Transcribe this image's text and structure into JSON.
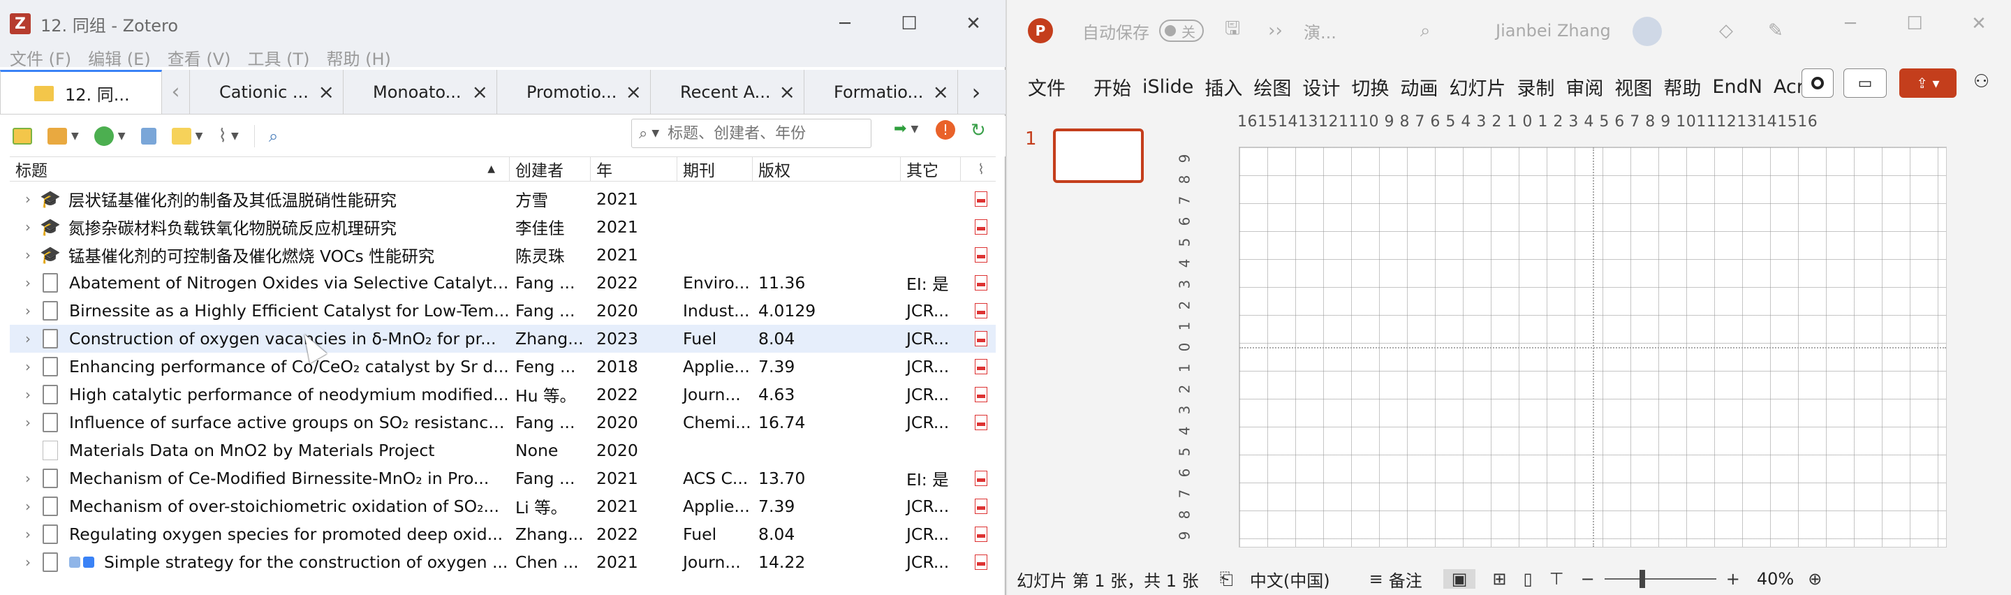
{
  "zotero": {
    "window_title": "12. 同组 - Zotero",
    "menu": [
      "文件 (F)",
      "编辑 (E)",
      "查看 (V)",
      "工具 (T)",
      "帮助 (H)"
    ],
    "library_tab": "12. 同...",
    "tabs": [
      "Cationic ...",
      "Monoato...",
      "Promotio...",
      "Recent A...",
      "Formatio..."
    ],
    "search_placeholder": "标题、创建者、年份",
    "columns": {
      "title": "标题",
      "creator": "创建者",
      "year": "年",
      "publication": "期刊",
      "rights": "版权",
      "extra": "其它"
    },
    "rows": [
      {
        "type": "thesis",
        "title": "层状锰基催化剂的制备及其低温脱硝性能研究",
        "creator": "方雪",
        "year": "2021",
        "publication": "",
        "rights": "",
        "extra": "",
        "pdf": true,
        "selected": false,
        "tags": []
      },
      {
        "type": "thesis",
        "title": "氮掺杂碳材料负载铁氧化物脱硫反应机理研究",
        "creator": "李佳佳",
        "year": "2021",
        "publication": "",
        "rights": "",
        "extra": "",
        "pdf": true,
        "selected": false,
        "tags": []
      },
      {
        "type": "thesis",
        "title": "锰基催化剂的可控制备及催化燃烧 VOCs 性能研究",
        "creator": "陈灵珠",
        "year": "2021",
        "publication": "",
        "rights": "",
        "extra": "",
        "pdf": true,
        "selected": false,
        "tags": []
      },
      {
        "type": "doc",
        "title": "Abatement of Nitrogen Oxides via Selective Catalyti...",
        "creator": "Fang ...",
        "year": "2022",
        "publication": "Enviro...",
        "rights": "11.36",
        "extra": "EI: 是",
        "pdf": true,
        "selected": false,
        "tags": []
      },
      {
        "type": "doc",
        "title": "Birnessite as a Highly Efficient Catalyst for Low-Tem...",
        "creator": "Fang ...",
        "year": "2020",
        "publication": "Indust...",
        "rights": "4.0129",
        "extra": "JCR...",
        "pdf": true,
        "selected": false,
        "tags": []
      },
      {
        "type": "doc",
        "title": "Construction of oxygen vacancies in δ-MnO₂ for pr...",
        "creator": "Zhang...",
        "year": "2023",
        "publication": "Fuel",
        "rights": "8.04",
        "extra": "JCR...",
        "pdf": true,
        "selected": true,
        "tags": []
      },
      {
        "type": "doc",
        "title": "Enhancing performance of Co/CeO₂ catalyst by Sr d...",
        "creator": "Feng ...",
        "year": "2018",
        "publication": "Applie...",
        "rights": "7.39",
        "extra": "JCR...",
        "pdf": true,
        "selected": false,
        "tags": []
      },
      {
        "type": "doc",
        "title": "High catalytic performance of neodymium modified...",
        "creator": "Hu 等。",
        "year": "2022",
        "publication": "Journ...",
        "rights": "4.63",
        "extra": "JCR...",
        "pdf": true,
        "selected": false,
        "tags": []
      },
      {
        "type": "doc",
        "title": "Influence of surface active groups on SO₂ resistance...",
        "creator": "Fang ...",
        "year": "2020",
        "publication": "Chemi...",
        "rights": "16.74",
        "extra": "JCR...",
        "pdf": true,
        "selected": false,
        "tags": []
      },
      {
        "type": "blank",
        "title": "Materials Data on MnO2 by Materials Project",
        "creator": "None",
        "year": "2020",
        "publication": "",
        "rights": "",
        "extra": "",
        "pdf": false,
        "selected": false,
        "tags": []
      },
      {
        "type": "doc",
        "title": "Mechanism of Ce-Modified Birnessite-MnO₂ in Pro...",
        "creator": "Fang ...",
        "year": "2021",
        "publication": "ACS C...",
        "rights": "13.70",
        "extra": "EI: 是",
        "pdf": true,
        "selected": false,
        "tags": []
      },
      {
        "type": "doc",
        "title": "Mechanism of over-stoichiometric oxidation of SO₂...",
        "creator": "Li 等。",
        "year": "2021",
        "publication": "Applie...",
        "rights": "7.39",
        "extra": "JCR...",
        "pdf": true,
        "selected": false,
        "tags": []
      },
      {
        "type": "doc",
        "title": "Regulating oxygen species for promoted deep oxid...",
        "creator": "Zhang...",
        "year": "2022",
        "publication": "Fuel",
        "rights": "8.04",
        "extra": "JCR...",
        "pdf": true,
        "selected": false,
        "tags": []
      },
      {
        "type": "doc",
        "title": "Simple strategy for the construction of oxygen ...",
        "creator": "Chen ...",
        "year": "2021",
        "publication": "Journ...",
        "rights": "14.22",
        "extra": "JCR...",
        "pdf": true,
        "selected": false,
        "tags": [
          "#8fb5e8",
          "#3a82f6"
        ]
      }
    ]
  },
  "ppt": {
    "autosave_label": "自动保存",
    "autosave_state": "关",
    "doc_title": "演...",
    "user_name": "Jianbei Zhang",
    "menu": [
      "文件",
      "开始",
      "iSlide",
      "插入",
      "绘图",
      "设计",
      "切换",
      "动画",
      "幻灯片",
      "录制",
      "审阅",
      "视图",
      "帮助",
      "EndN",
      "Acrob"
    ],
    "slide_number": "1",
    "ruler_h": "16151413121110 9 8 7 6 5 4 3 2 1 0 1 2 3 4 5 6 7 8 9 10111213141516",
    "ruler_v": [
      "9",
      "8",
      "7",
      "6",
      "5",
      "4",
      "3",
      "2",
      "1",
      "0",
      "1",
      "2",
      "3",
      "4",
      "5",
      "6",
      "7",
      "8",
      "9"
    ],
    "status": {
      "slide_info": "幻灯片 第 1 张，共 1 张",
      "language": "中文(中国)",
      "notes": "备注",
      "zoom": "40%"
    }
  }
}
